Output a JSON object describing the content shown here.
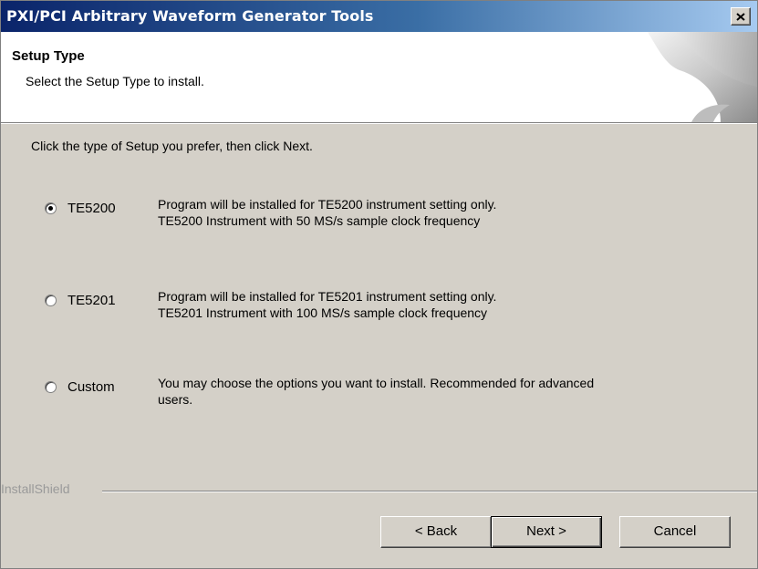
{
  "window": {
    "title": "PXI/PCI Arbitrary Waveform Generator Tools"
  },
  "header": {
    "title": "Setup Type",
    "subtitle": "Select the Setup Type to install."
  },
  "intro": "Click the type of Setup you prefer, then click Next.",
  "options": [
    {
      "label": "TE5200",
      "checked": true,
      "line1": "Program will be installed for TE5200 instrument setting only.",
      "line2": "TE5200 Instrument with 50 MS/s sample clock frequency"
    },
    {
      "label": "TE5201",
      "checked": false,
      "line1": "Program will be installed for TE5201 instrument setting only.",
      "line2": "TE5201 Instrument with 100 MS/s sample clock frequency"
    },
    {
      "label": "Custom",
      "checked": false,
      "line1": "You may choose the options you want to install. Recommended for advanced",
      "line2": "users."
    }
  ],
  "footer": {
    "brand": "InstallShield",
    "back_label": "< Back",
    "next_label": "Next >",
    "cancel_label": "Cancel"
  },
  "colors": {
    "titlebar_start": "#0a246a",
    "titlebar_end": "#a6caf0",
    "dialog_face": "#d4d0c8"
  }
}
